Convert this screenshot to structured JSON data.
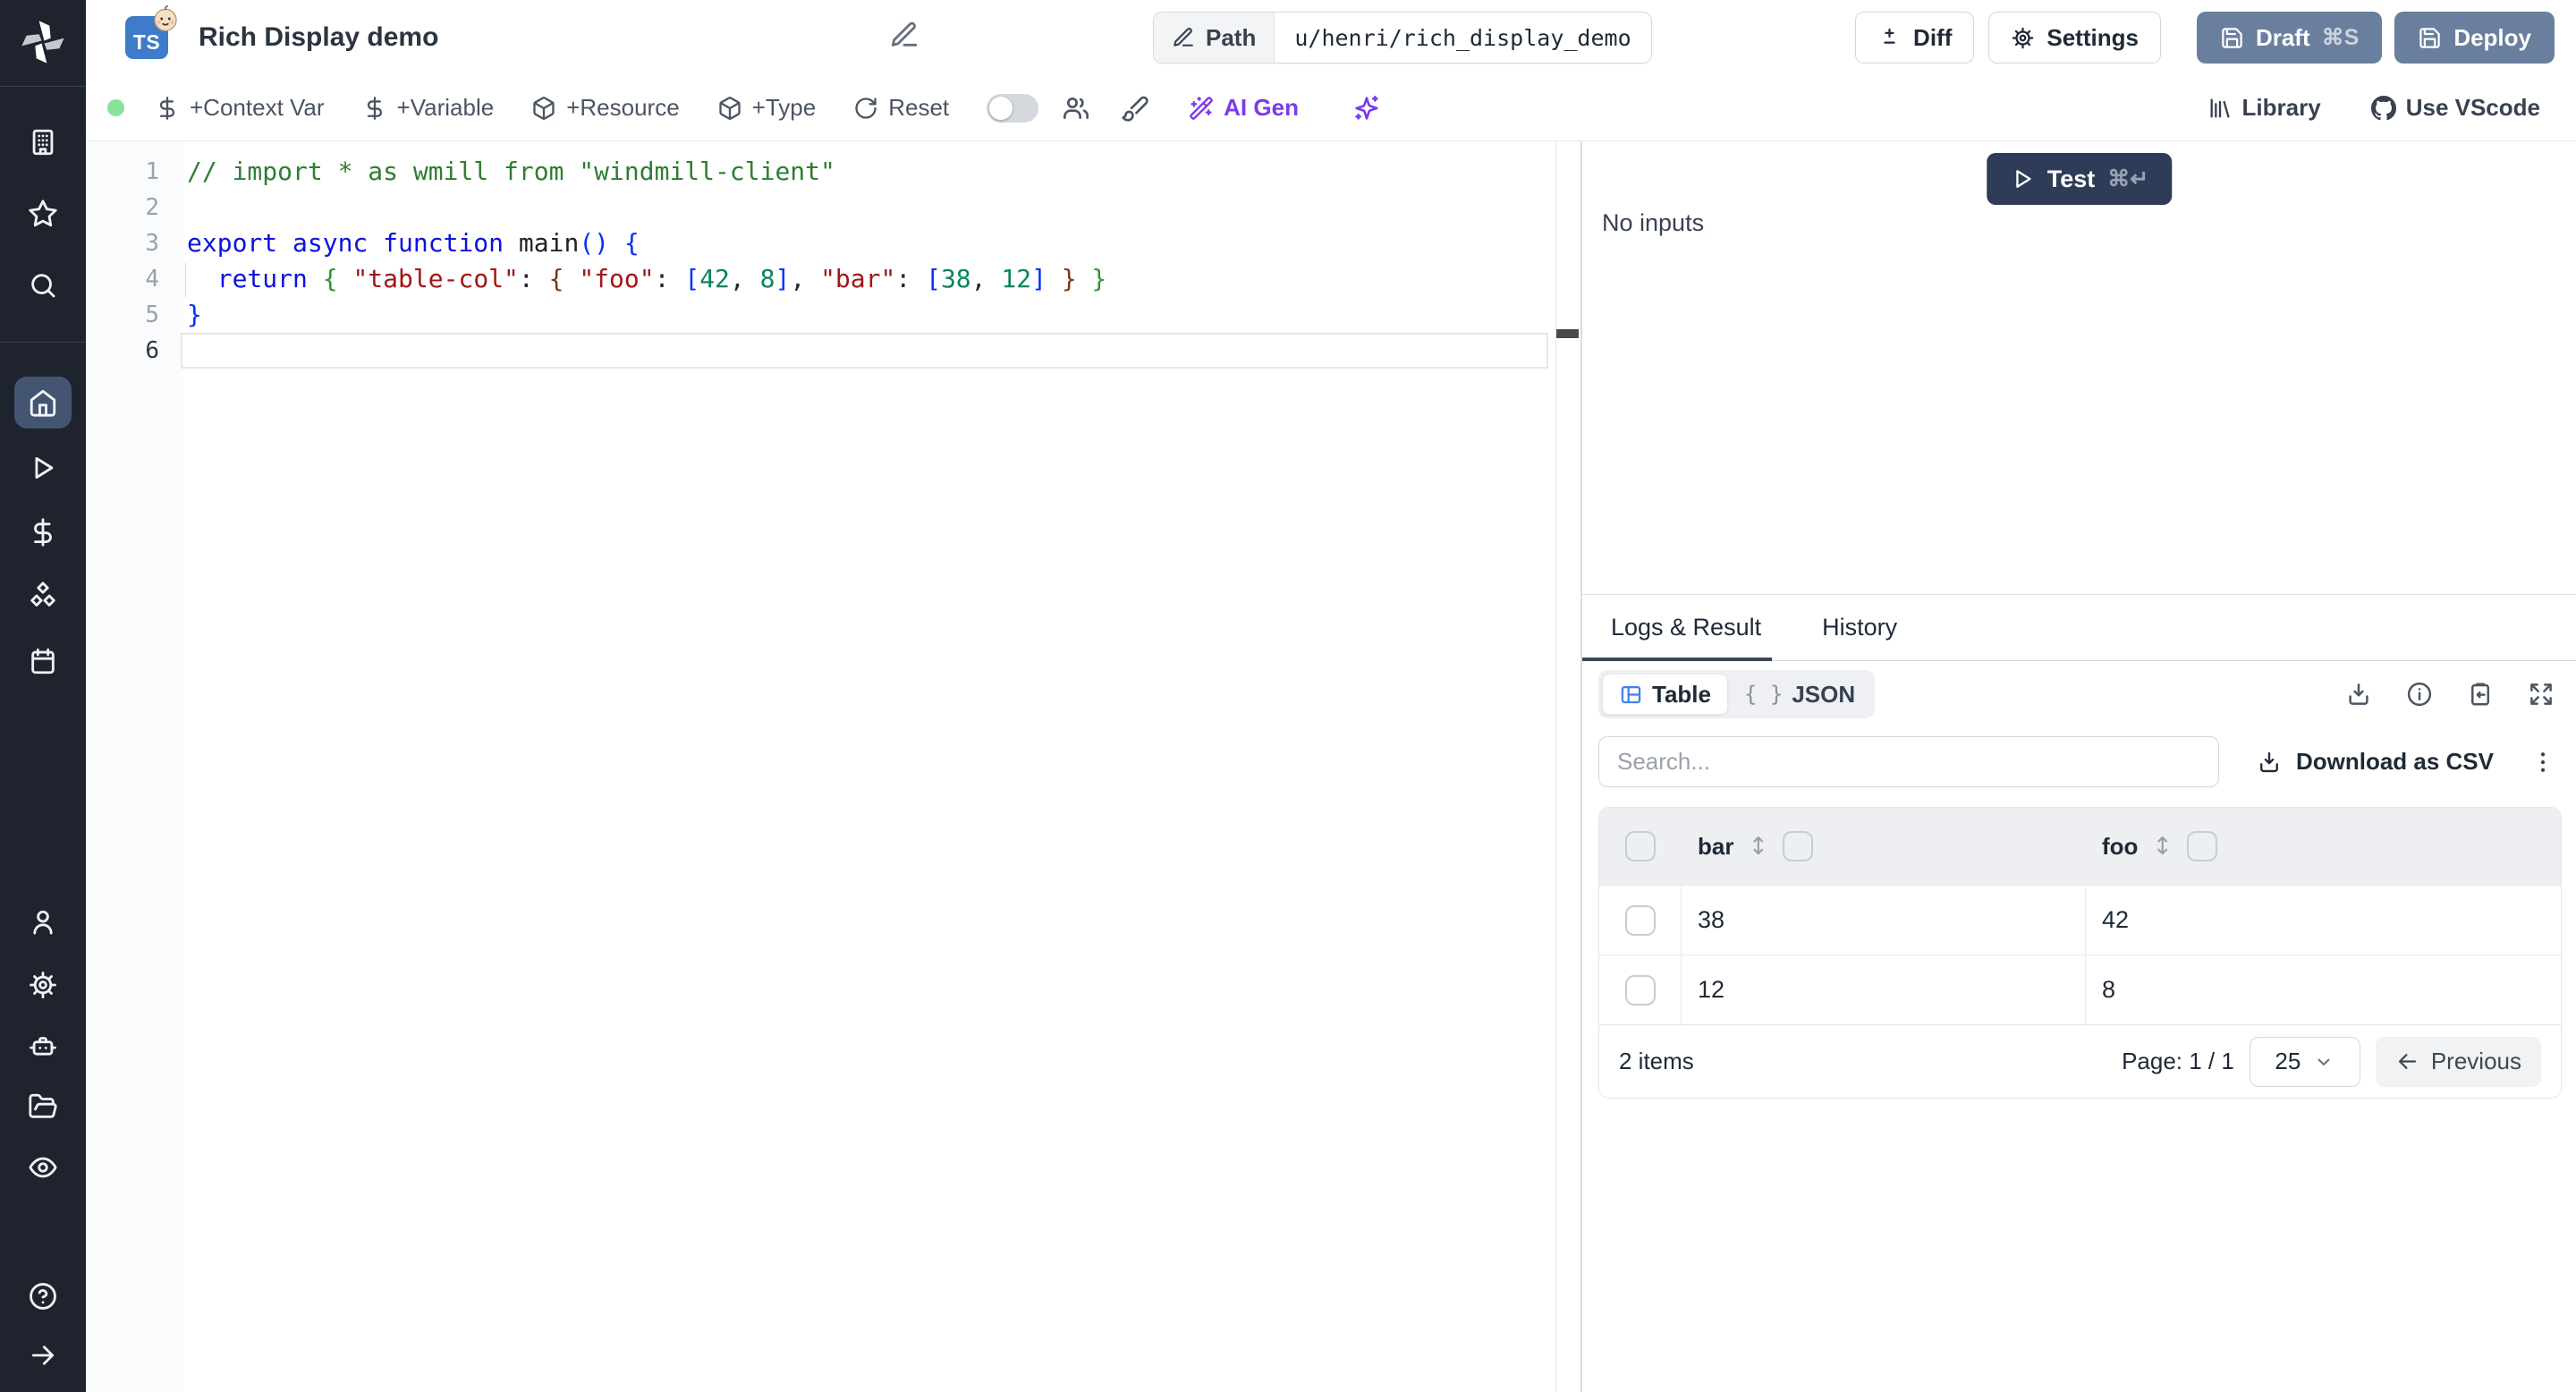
{
  "sidebar": {
    "icons": [
      "windmill-logo",
      "building",
      "star",
      "search",
      "home",
      "play",
      "dollar",
      "boxes",
      "calendar",
      "user",
      "settings",
      "robot",
      "folder-open",
      "eye",
      "help",
      "expand-arrow"
    ],
    "active_item": "home"
  },
  "header": {
    "language_badge": "TS",
    "title": "Rich Display demo",
    "path_label": "Path",
    "path_value": "u/henri/rich_display_demo",
    "diff_label": "Diff",
    "settings_label": "Settings",
    "draft_label": "Draft",
    "draft_shortcut": "⌘S",
    "deploy_label": "Deploy"
  },
  "toolbar": {
    "items": [
      "+Context Var",
      "+Variable",
      "+Resource",
      "+Type",
      "Reset"
    ],
    "ai_gen_label": "AI Gen",
    "library_label": "Library",
    "vscode_label": "Use VScode"
  },
  "editor": {
    "line_numbers": [
      "1",
      "2",
      "3",
      "4",
      "5",
      "6"
    ],
    "lines": {
      "1": [
        [
          "// import * as wmill from \"windmill-client\"",
          "cm"
        ]
      ],
      "3": [
        [
          "export async function ",
          "kw"
        ],
        [
          "main",
          "fn"
        ],
        [
          "(",
          "b1"
        ],
        [
          ")",
          "b1"
        ],
        [
          " ",
          "pl"
        ],
        [
          "{",
          "b1"
        ]
      ],
      "4": [
        [
          "  ",
          "pl"
        ],
        [
          "return",
          "kw"
        ],
        [
          " ",
          "pl"
        ],
        [
          "{",
          "b2"
        ],
        [
          " ",
          "pl"
        ],
        [
          "\"table-col\"",
          "str"
        ],
        [
          ": ",
          "pl"
        ],
        [
          "{",
          "b3"
        ],
        [
          " ",
          "pl"
        ],
        [
          "\"foo\"",
          "str"
        ],
        [
          ": ",
          "pl"
        ],
        [
          "[",
          "b1"
        ],
        [
          "42",
          "num"
        ],
        [
          ", ",
          "pl"
        ],
        [
          "8",
          "num"
        ],
        [
          "]",
          "b1"
        ],
        [
          ", ",
          "pl"
        ],
        [
          "\"bar\"",
          "str"
        ],
        [
          ": ",
          "pl"
        ],
        [
          "[",
          "b1"
        ],
        [
          "38",
          "num"
        ],
        [
          ", ",
          "pl"
        ],
        [
          "12",
          "num"
        ],
        [
          "]",
          "b1"
        ],
        [
          " ",
          "pl"
        ],
        [
          "}",
          "b3"
        ],
        [
          " ",
          "pl"
        ],
        [
          "}",
          "b2"
        ]
      ],
      "5": [
        [
          "}",
          "b1"
        ]
      ]
    }
  },
  "run_panel": {
    "test_label": "Test",
    "test_shortcut": "⌘↵",
    "no_inputs": "No inputs"
  },
  "result_panel": {
    "tabs": {
      "logs": "Logs & Result",
      "history": "History"
    },
    "view_toggle": {
      "table": "Table",
      "json_braces": "{ }",
      "json": "JSON"
    },
    "search_placeholder": "Search...",
    "download_csv_label": "Download as CSV",
    "table": {
      "columns": [
        "bar",
        "foo"
      ],
      "sort_glyph": "↕",
      "rows": [
        {
          "bar": "38",
          "foo": "42"
        },
        {
          "bar": "12",
          "foo": "8"
        }
      ],
      "items_label": "2 items",
      "page_label": "Page: 1 / 1",
      "page_size": "25",
      "previous_label": "Previous"
    }
  },
  "colors": {
    "sidebar_bg": "#1f232e",
    "accent_purple": "#7c3aed",
    "button_slate": "#697f9d",
    "test_button_navy": "#2e3c58",
    "status_green": "#88e29b",
    "ts_badge_blue": "#3f7bc8",
    "active_sidebar_item": "#445572",
    "table_header_bg": "#edeff2"
  }
}
